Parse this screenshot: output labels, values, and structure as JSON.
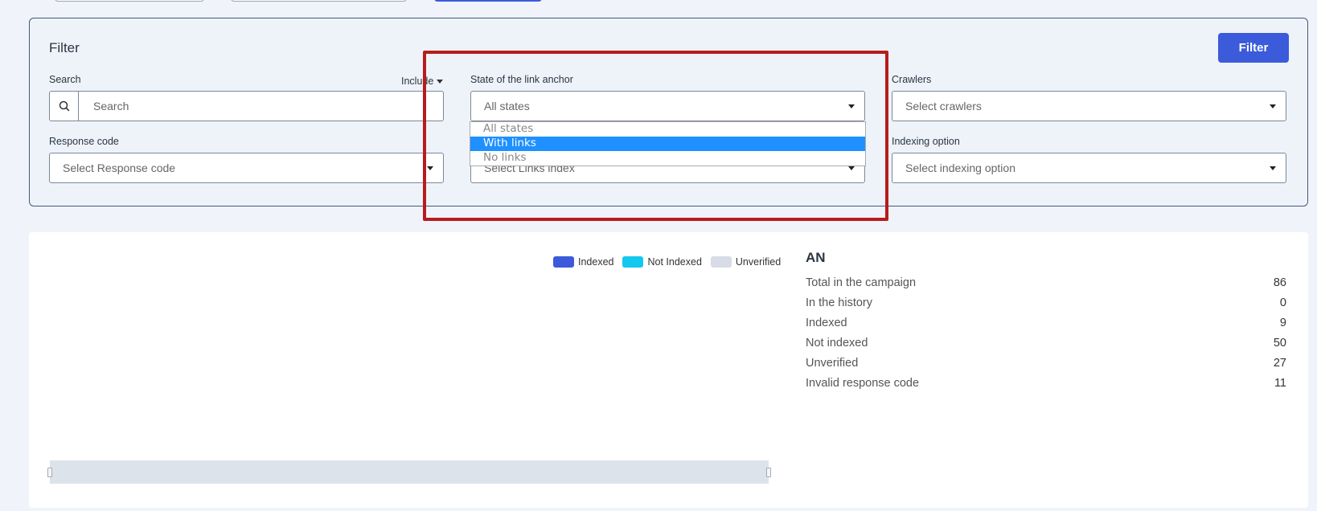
{
  "filter": {
    "title": "Filter",
    "button_label": "Filter",
    "search": {
      "label": "Search",
      "placeholder": "Search",
      "include_label": "Include"
    },
    "link_anchor": {
      "label": "State of the link anchor",
      "placeholder": "All states",
      "options": [
        "All states",
        "With links",
        "No links"
      ],
      "highlighted_option": "With links"
    },
    "crawlers": {
      "label": "Crawlers",
      "placeholder": "Select crawlers"
    },
    "response_code": {
      "label": "Response code",
      "placeholder": "Select Response code"
    },
    "links_index": {
      "placeholder": "Select Links index"
    },
    "indexing_option": {
      "label": "Indexing option",
      "placeholder": "Select indexing option"
    }
  },
  "legend": [
    {
      "label": "Indexed",
      "color": "#3b5bdb"
    },
    {
      "label": "Not Indexed",
      "color": "#12c8ee"
    },
    {
      "label": "Unverified",
      "color": "#d7dce6"
    }
  ],
  "stats": {
    "title": "AN",
    "rows": [
      {
        "label": "Total in the campaign",
        "value": "86"
      },
      {
        "label": "In the history",
        "value": "0"
      },
      {
        "label": "Indexed",
        "value": "9"
      },
      {
        "label": "Not indexed",
        "value": "50"
      },
      {
        "label": "Unverified",
        "value": "27"
      },
      {
        "label": "Invalid response code",
        "value": "11"
      }
    ]
  },
  "colors": {
    "accent": "#3b5bdb",
    "highlight_border": "#b71c1c",
    "dropdown_selected": "#1e90ff"
  }
}
